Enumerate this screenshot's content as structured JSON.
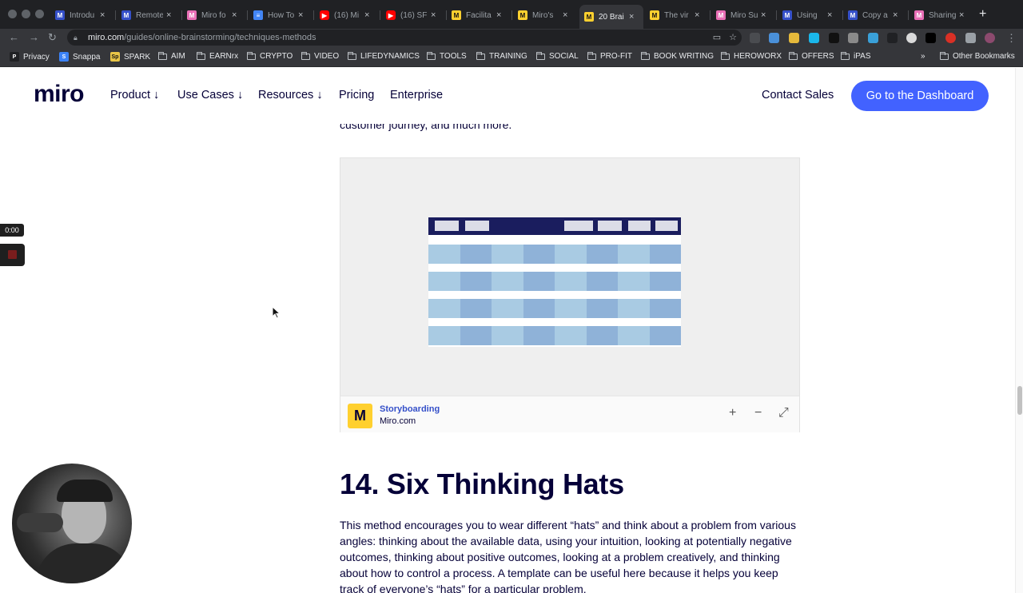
{
  "browser": {
    "tabs": [
      {
        "title": "Introdu",
        "icon": "miro-icon",
        "active": false
      },
      {
        "title": "Remote",
        "icon": "miro-icon",
        "active": false
      },
      {
        "title": "Miro fo",
        "icon": "miro-pink-icon",
        "active": false
      },
      {
        "title": "How To",
        "icon": "google-docs-icon",
        "active": false
      },
      {
        "title": "(16) Mi",
        "icon": "youtube-icon",
        "active": false
      },
      {
        "title": "(16) SF",
        "icon": "youtube-icon",
        "active": false
      },
      {
        "title": "Facilita",
        "icon": "miro-yellow-icon",
        "active": false
      },
      {
        "title": "Miro's",
        "icon": "miro-yellow-icon",
        "active": false
      },
      {
        "title": "20 Brai",
        "icon": "miro-yellow-icon",
        "active": true
      },
      {
        "title": "The vir",
        "icon": "miro-yellow-icon",
        "active": false
      },
      {
        "title": "Miro Su",
        "icon": "miro-pink-icon",
        "active": false
      },
      {
        "title": "Using",
        "icon": "miro-icon",
        "active": false
      },
      {
        "title": "Copy a",
        "icon": "miro-icon",
        "active": false
      },
      {
        "title": "Sharing",
        "icon": "miro-pink-icon",
        "active": false
      }
    ],
    "url_host": "miro.com",
    "url_path": "/guides/online-brainstorming/techniques-methods",
    "bookmarks": [
      {
        "label": "Privacy",
        "kind": "icon"
      },
      {
        "label": "Snappa",
        "kind": "icon"
      },
      {
        "label": "SPARK",
        "kind": "icon"
      },
      {
        "label": "AIM",
        "kind": "folder"
      },
      {
        "label": "EARNrx",
        "kind": "folder"
      },
      {
        "label": "CRYPTO",
        "kind": "folder"
      },
      {
        "label": "VIDEO",
        "kind": "folder"
      },
      {
        "label": "LIFEDYNAMICS",
        "kind": "folder"
      },
      {
        "label": "TOOLS",
        "kind": "folder"
      },
      {
        "label": "TRAINING",
        "kind": "folder"
      },
      {
        "label": "SOCIAL",
        "kind": "folder"
      },
      {
        "label": "PRO-FIT",
        "kind": "folder"
      },
      {
        "label": "BOOK WRITING",
        "kind": "folder"
      },
      {
        "label": "HEROWORX",
        "kind": "folder"
      },
      {
        "label": "OFFERS",
        "kind": "folder"
      },
      {
        "label": "iPAS",
        "kind": "folder"
      }
    ],
    "bookmarks_overflow": "»",
    "other_bookmarks": "Other Bookmarks"
  },
  "nav": {
    "logo": "miro",
    "links": [
      "Product ↓",
      "Use Cases ↓",
      "Resources ↓",
      "Pricing",
      "Enterprise"
    ],
    "contact": "Contact Sales",
    "cta": "Go to the Dashboard"
  },
  "content": {
    "prev_tail": "customer journey, and much more.",
    "embed": {
      "title": "Storyboarding",
      "source": "Miro.com",
      "zoom_in": "+",
      "zoom_out": "−",
      "fullscreen": "⤢"
    },
    "heading": "14. Six Thinking Hats",
    "paragraph": "This method encourages you to wear different “hats” and think about a problem from various angles: thinking about the available data, using your intuition, looking at potentially negative outcomes, thinking about positive outcomes, looking at a problem creatively, and thinking about how to control a process. A template can be useful here because it helps you keep track of everyone’s “hats” for a particular problem."
  },
  "recorder": {
    "time": "0:00"
  },
  "colors": {
    "brand_blue": "#4262ff",
    "ink": "#050038",
    "miro_yellow": "#ffd02f"
  }
}
